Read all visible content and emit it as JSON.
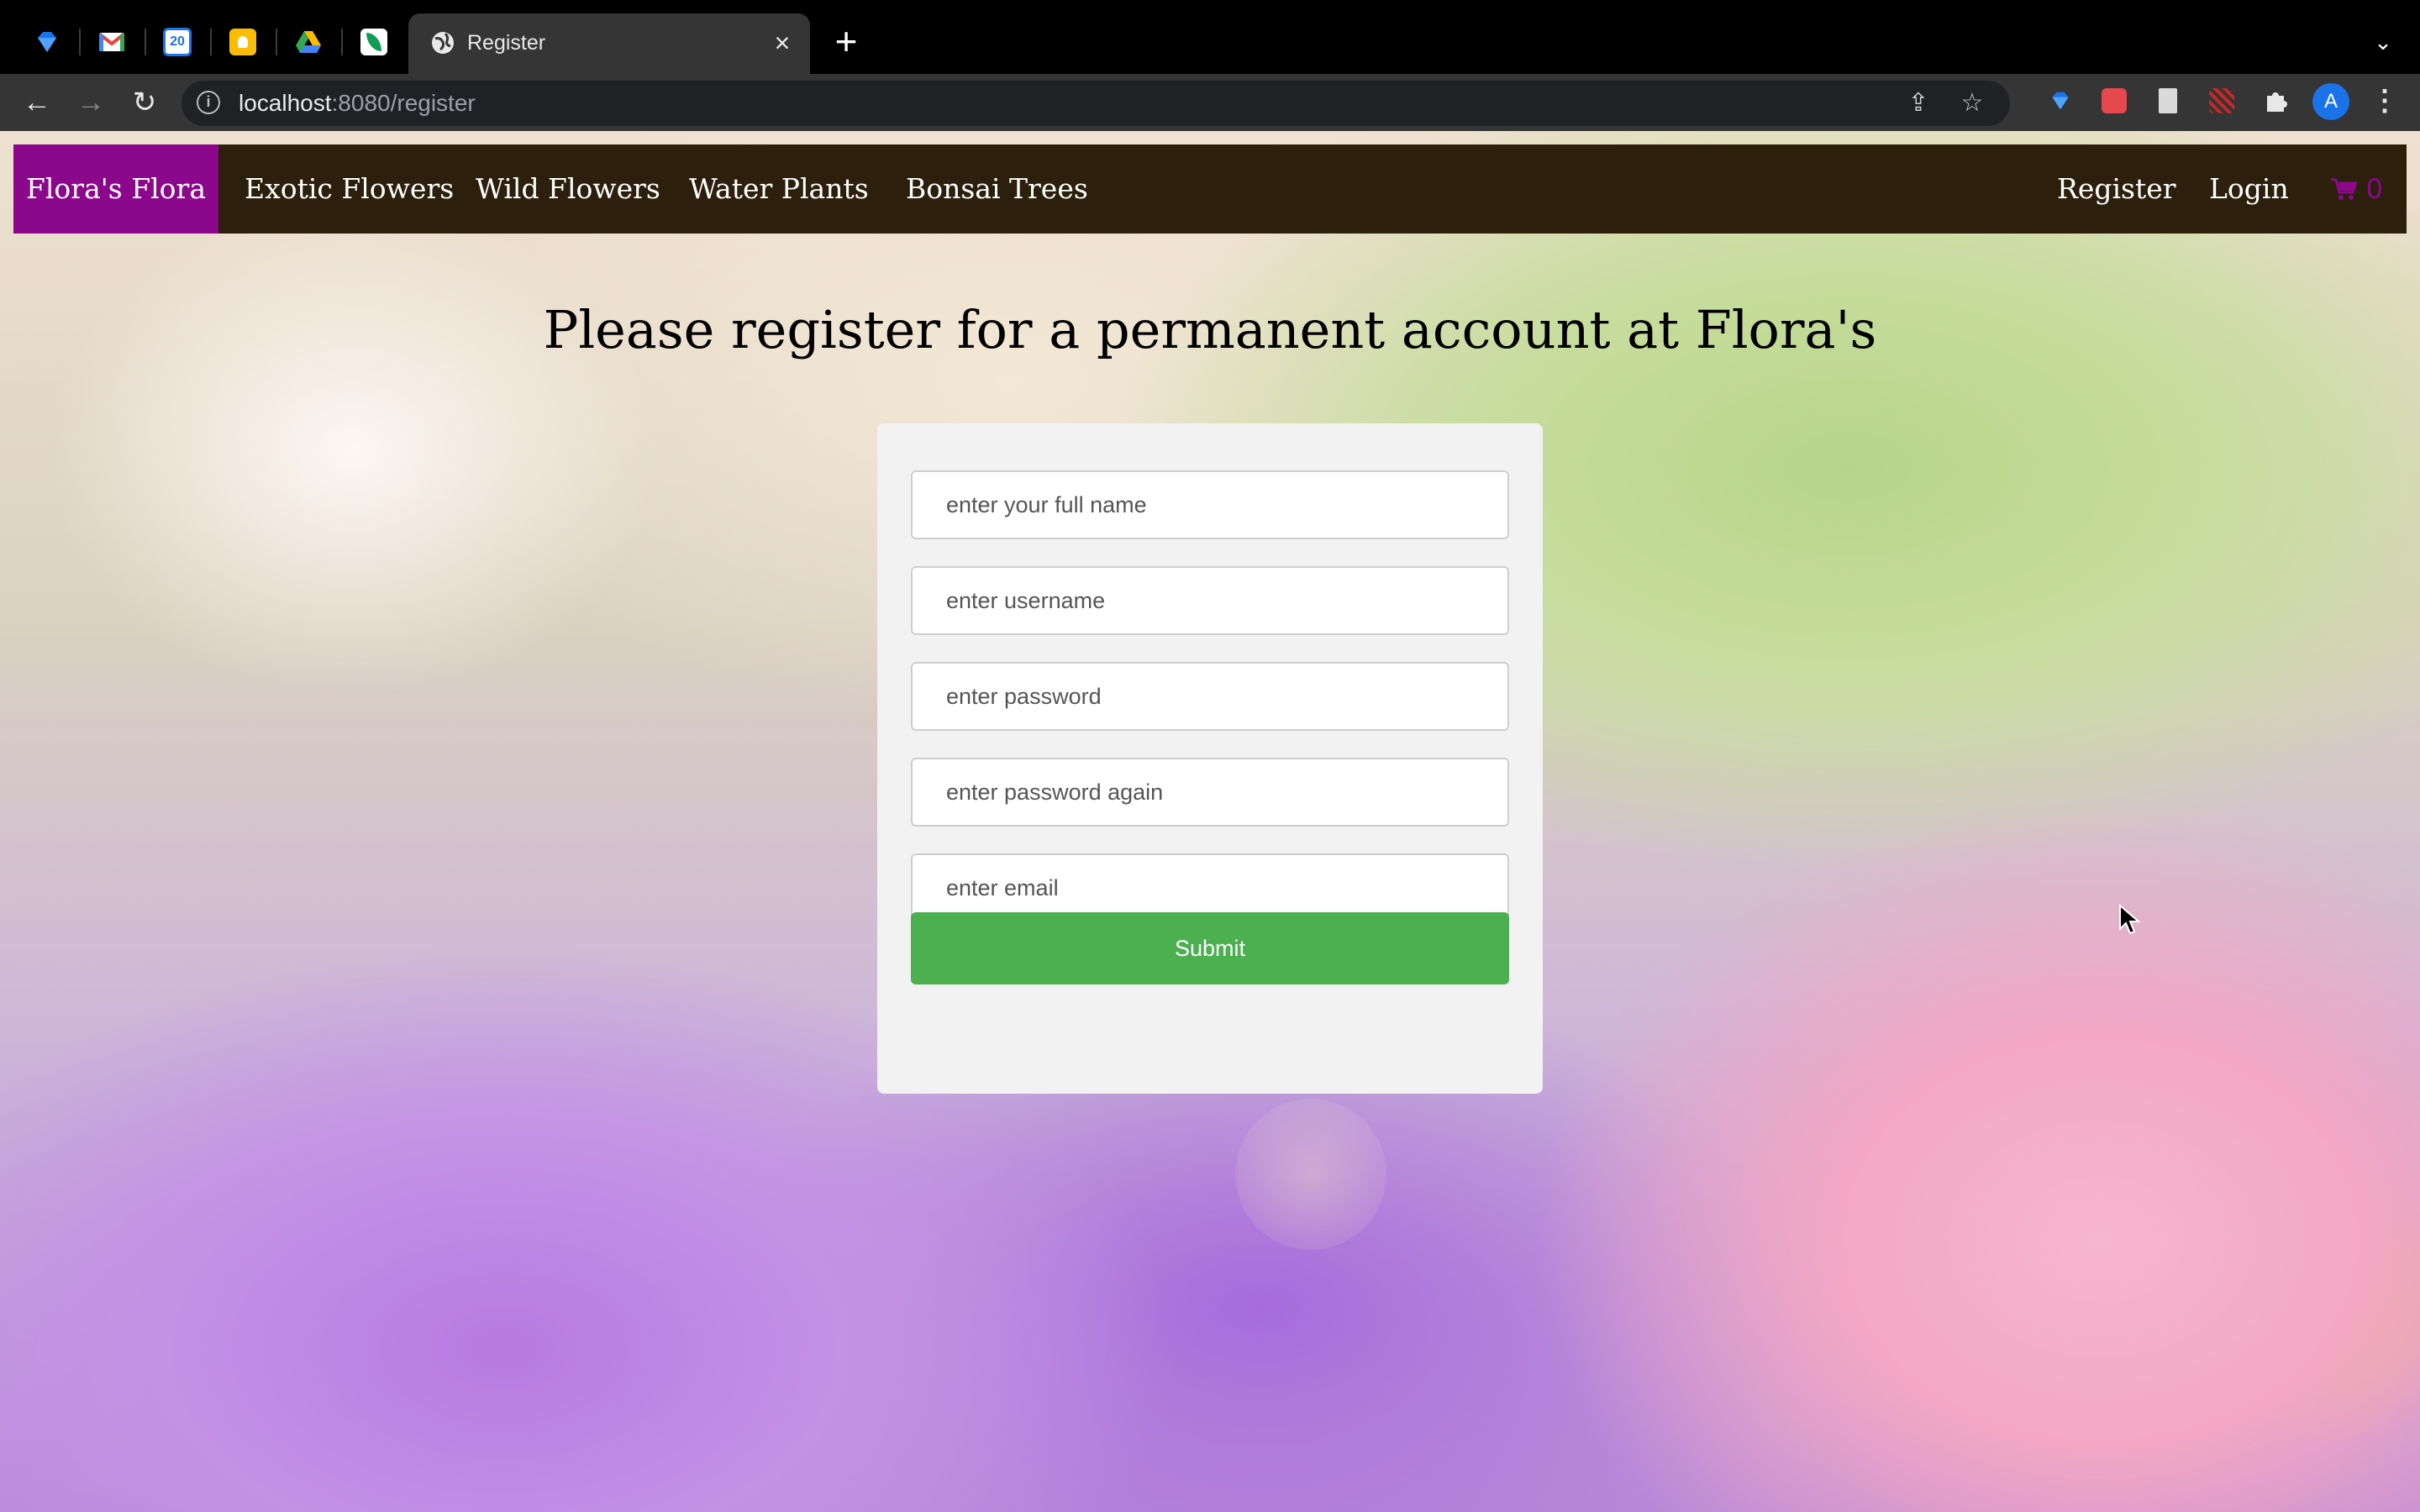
{
  "browser": {
    "tabs": [
      {
        "icon": "diamond-icon",
        "color": "#1a73e8"
      },
      {
        "icon": "gmail-icon",
        "color": "#ea4335"
      },
      {
        "icon": "calendar-icon",
        "label": "20",
        "color": "#1a73e8"
      },
      {
        "icon": "keep-icon",
        "color": "#fbbc04"
      },
      {
        "icon": "drive-icon",
        "color": "#34a853"
      },
      {
        "icon": "leaf-icon",
        "color": "#0f9d58"
      }
    ],
    "active_tab": {
      "title": "Register",
      "icon": "globe-icon"
    },
    "address": {
      "host": "localhost",
      "path": ":8080/register"
    },
    "profile_initial": "A"
  },
  "site": {
    "brand": "Flora's Flora",
    "nav_left": [
      "Exotic Flowers",
      "Wild Flowers",
      "Water Plants",
      "Bonsai Trees"
    ],
    "nav_right": {
      "register": "Register",
      "login": "Login"
    },
    "cart_count": "0",
    "brand_color": "#8b078b",
    "nav_color": "#2c200c"
  },
  "page": {
    "heading": "Please register for a permanent account at Flora's",
    "form": {
      "fullname_placeholder": "enter your full name",
      "username_placeholder": "enter username",
      "password_placeholder": "enter password",
      "password_again_placeholder": "enter password again",
      "email_placeholder": "enter email",
      "submit_label": "Submit",
      "submit_color": "#4caf50"
    }
  }
}
